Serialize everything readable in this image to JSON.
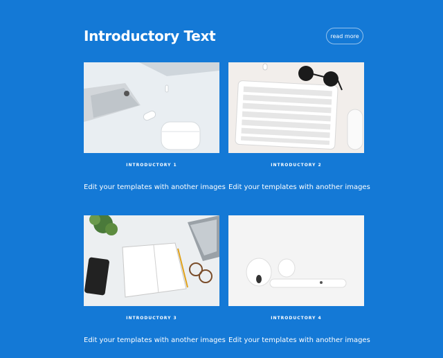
{
  "section": {
    "title": "Introductory Text",
    "read_more_label": "read more"
  },
  "cards": [
    {
      "label": "INTRODUCTORY 1",
      "caption": "Edit your templates with another images",
      "image": "desk-phone-airpods-photo"
    },
    {
      "label": "INTRODUCTORY 2",
      "caption": "Edit your templates with another images",
      "image": "keyboard-sunglasses-photo"
    },
    {
      "label": "INTRODUCTORY 3",
      "caption": "Edit your templates with another images",
      "image": "notebook-phone-laptop-photo"
    },
    {
      "label": "INTRODUCTORY 4",
      "caption": "Edit your templates with another images",
      "image": "airpods-case-photo"
    }
  ],
  "colors": {
    "background": "#1479d6",
    "text": "#ffffff"
  }
}
